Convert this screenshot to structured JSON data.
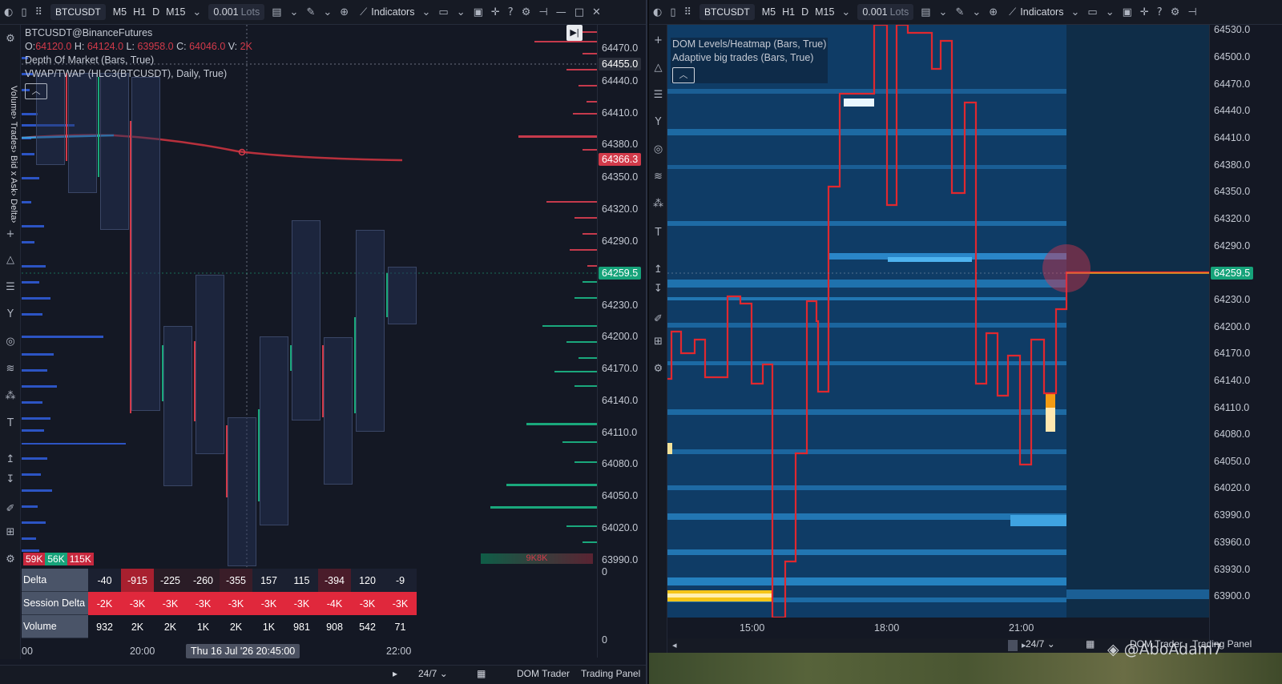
{
  "left": {
    "toolbar": {
      "symbol": "BTCUSDT",
      "timeframes": [
        "M5",
        "H1",
        "D",
        "M15"
      ],
      "lots_value": "0.001",
      "lots_unit": "Lots",
      "indicators_label": "Indicators"
    },
    "legend": {
      "symbol_line": "BTCUSDT@BinanceFutures",
      "ohlc": {
        "o_label": "O:",
        "o": "64120.0",
        "h_label": "H:",
        "h": "64124.0",
        "l_label": "L:",
        "l": "63958.0",
        "c_label": "C:",
        "c": "64046.0",
        "v_label": "V:",
        "v": "2K"
      },
      "indicator1": "Depth Of Market (Bars, True)",
      "indicator2": "VWAP/TWAP (HLC3(BTCUSDT), Daily, True)"
    },
    "side_tabs": "Volume› Trades› Bid x Ask› Delta›",
    "price_labels": [
      "64470.0",
      "64440.0",
      "64410.0",
      "64380.0",
      "64350.0",
      "64320.0",
      "64290.0",
      "64230.0",
      "64200.0",
      "64170.0",
      "64140.0",
      "64110.0",
      "64080.0",
      "64050.0",
      "64020.0",
      "63990.0"
    ],
    "highlight_prices": {
      "crosshair": "64455.0",
      "vwap": "64366.3",
      "last": "64259.5"
    },
    "axis_zero_labels": [
      "0",
      "0"
    ],
    "volume_boxes": {
      "sell": "59K",
      "buy": "56K",
      "total": "115K"
    },
    "dom_bottom_label": "9K8K",
    "footer": {
      "delta_label": "Delta",
      "session_delta_label": "Session Delta",
      "volume_label": "Volume",
      "delta": [
        "-40",
        "-915",
        "-225",
        "-260",
        "-355",
        "157",
        "115",
        "-394",
        "120",
        "-9"
      ],
      "session_delta": [
        "-2K",
        "-3K",
        "-3K",
        "-3K",
        "-3K",
        "-3K",
        "-3K",
        "-4K",
        "-3K",
        "-3K"
      ],
      "volume": [
        "932",
        "2K",
        "2K",
        "1K",
        "2K",
        "1K",
        "981",
        "908",
        "542",
        "71"
      ]
    },
    "time_labels": {
      "t0": "00",
      "t1": "20:00",
      "crosshair": "Thu 16 Jul '26 20:45:00",
      "t2": "22:00"
    },
    "bottombar": {
      "session": "24/7",
      "dom": "DOM Trader",
      "panel": "Trading Panel"
    }
  },
  "right": {
    "toolbar": {
      "symbol": "BTCUSDT",
      "timeframes": [
        "M5",
        "H1",
        "D",
        "M15"
      ],
      "lots_value": "0.001",
      "lots_unit": "Lots",
      "indicators_label": "Indicators"
    },
    "legend": {
      "indicator1": "DOM Levels/Heatmap (Bars, True)",
      "indicator2": "Adaptive big trades (Bars, True)"
    },
    "price_labels": [
      "64530.0",
      "64500.0",
      "64470.0",
      "64440.0",
      "64410.0",
      "64380.0",
      "64350.0",
      "64320.0",
      "64290.0",
      "64230.0",
      "64200.0",
      "64170.0",
      "64140.0",
      "64110.0",
      "64080.0",
      "64050.0",
      "64020.0",
      "63990.0",
      "63960.0",
      "63930.0",
      "63900.0"
    ],
    "last_price": "64259.5",
    "time_labels": [
      "15:00",
      "18:00",
      "21:00"
    ],
    "bottombar": {
      "session": "24/7",
      "dom": "DOM Trader",
      "panel": "Trading Panel"
    },
    "watermark": "@AboAdam7"
  },
  "colors": {
    "bear": "#d23a4a",
    "bull": "#16a37a",
    "vwap": "#b8303c",
    "heatmap_bg": "#12416c",
    "bid_profile": "#2f5bd6"
  }
}
